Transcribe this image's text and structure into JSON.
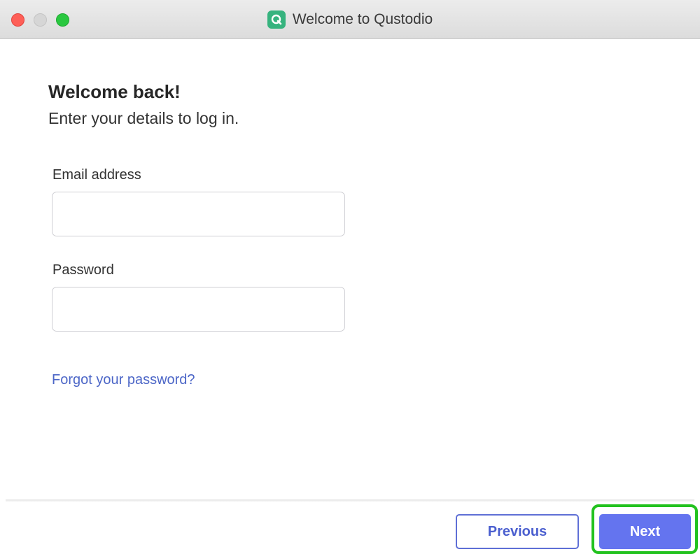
{
  "window": {
    "title": "Welcome to Qustodio",
    "app_icon": "qustodio-logo-icon",
    "app_icon_color": "#36b37e"
  },
  "login": {
    "heading": "Welcome back!",
    "subheading": "Enter your details to log in.",
    "email": {
      "label": "Email address",
      "value": "",
      "placeholder": ""
    },
    "password": {
      "label": "Password",
      "value": "",
      "placeholder": ""
    },
    "forgot_link": "Forgot your password?"
  },
  "footer": {
    "previous_label": "Previous",
    "next_label": "Next"
  },
  "colors": {
    "accent": "#6474ef",
    "link": "#4c66c7",
    "highlight": "#22c21e"
  }
}
